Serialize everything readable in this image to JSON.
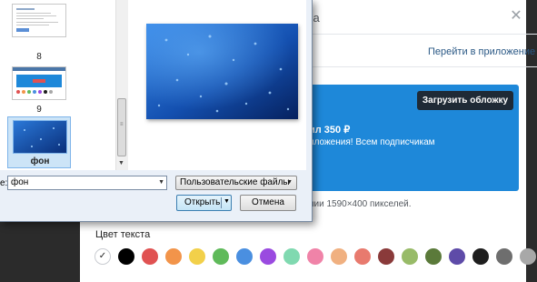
{
  "background_app": {
    "title_fragment": "са",
    "close_icon": "close-icon",
    "go_to_app_link": "Перейти в приложение",
    "cover": {
      "upload_button": "Загрузить обложку",
      "promo_line1": "ил 350 ₽",
      "promo_line2": "иложения! Всем подписчикам"
    },
    "size_hint": "нии 1590×400 пикселей.",
    "text_color": {
      "label": "Цвет текста",
      "selected_index": 0,
      "swatches": [
        "#ffffff",
        "#000000",
        "#e05252",
        "#f2944a",
        "#f2d04a",
        "#5fba5a",
        "#4a8fe0",
        "#9a4ae0",
        "#80d9b0",
        "#f083a8",
        "#f0b080",
        "#e87a6e",
        "#8a3a3a",
        "#98bb68",
        "#5b7a3a",
        "#5e4ba8",
        "#1e1e1e",
        "#6e6e6e",
        "#a8a8a8",
        "#cccccc"
      ]
    },
    "colors": {
      "link": "#2a5885",
      "banner": "#1e88d9",
      "button_dark": "#1f2a36"
    }
  },
  "file_dialog": {
    "thumbnails": [
      {
        "label": "8",
        "kind": "document"
      },
      {
        "label": "9",
        "kind": "webpage"
      },
      {
        "label": "фон",
        "kind": "blue-wallpaper",
        "selected": true
      }
    ],
    "filename_label": "е:",
    "filename_value": "фон",
    "filetype_value": "Пользовательские файлы",
    "open_button": "Открыть",
    "cancel_button": "Отмена"
  }
}
